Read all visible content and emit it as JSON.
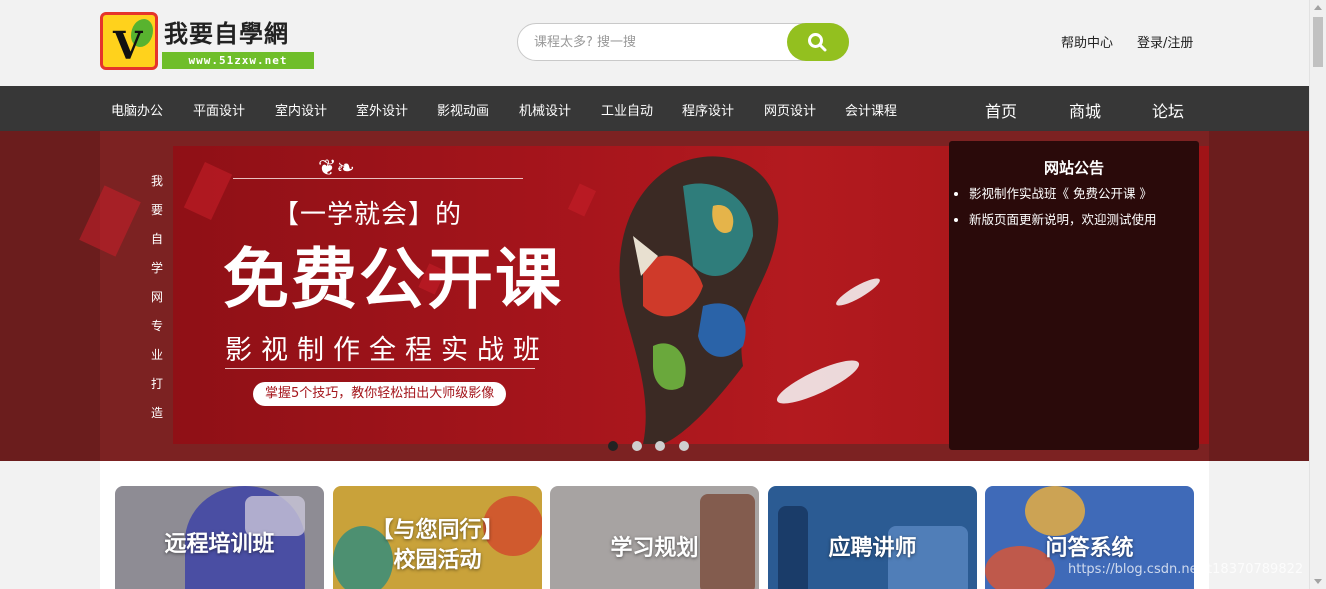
{
  "header": {
    "logo_title": "我要自學網",
    "logo_url": "www.51zxw.net",
    "search_placeholder": "课程太多? 搜一搜",
    "help_link": "帮助中心",
    "login_link": "登录/注册"
  },
  "nav": {
    "categories": [
      "电脑办公",
      "平面设计",
      "室内设计",
      "室外设计",
      "影视动画",
      "机械设计",
      "工业自动",
      "程序设计",
      "网页设计",
      "会计课程"
    ],
    "main": [
      "首页",
      "商城",
      "论坛"
    ]
  },
  "banner": {
    "vertical_text": [
      "我",
      "要",
      "自",
      "学",
      "网",
      "专",
      "业",
      "打",
      "造"
    ],
    "ornament": "❦❧",
    "subtitle": "【一学就会】的",
    "title": "免费公开课",
    "course": "影视制作全程实战班",
    "pill": "掌握5个技巧，教你轻松拍出大师级影像",
    "slides_total": 4,
    "active_slide": 1
  },
  "notice": {
    "title": "网站公告",
    "items": [
      "影视制作实战班《 免费公开课 》",
      "新版页面更新说明，欢迎测试使用"
    ]
  },
  "cards": [
    {
      "line1": "远程培训班",
      "line2": "",
      "color": "#8e8c94"
    },
    {
      "line1": "【与您同行】",
      "line2": "校园活动",
      "color": "#c9a23a"
    },
    {
      "line1": "学习规划",
      "line2": "",
      "color": "#a7a3a2"
    },
    {
      "line1": "应聘讲师",
      "line2": "",
      "color": "#2b5b93"
    },
    {
      "line1": "问答系统",
      "line2": "",
      "color": "#3f6ab8"
    }
  ],
  "watermark": "https://blog.csdn.net/t18370789822",
  "colors": {
    "accent_green": "#93c01f",
    "nav_bg": "#373737",
    "banner_red": "#a7151c"
  }
}
